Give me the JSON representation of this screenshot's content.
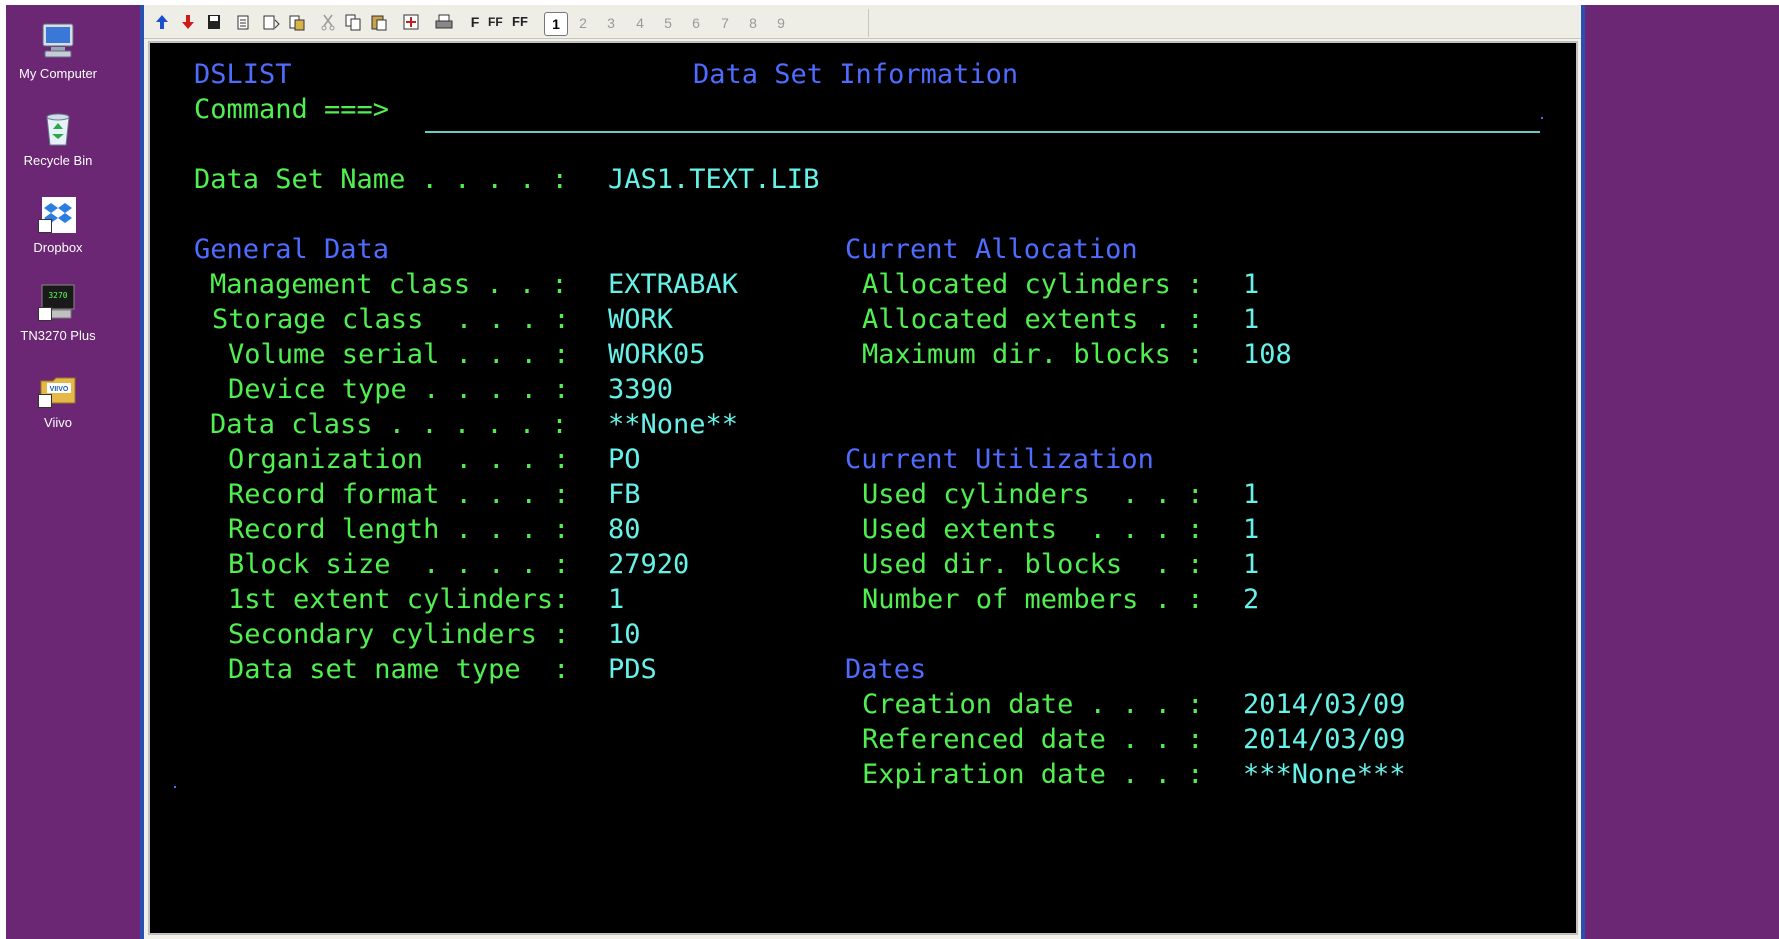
{
  "desktop": {
    "icons": [
      {
        "label": "My Computer"
      },
      {
        "label": "Recycle Bin"
      },
      {
        "label": "Dropbox"
      },
      {
        "label": "TN3270 Plus",
        "badge": "3270"
      },
      {
        "label": "Viivo",
        "badge": "VIIVO"
      }
    ]
  },
  "toolbar": {
    "font_buttons": [
      "F",
      "FF",
      "FF"
    ],
    "pages": [
      "1",
      "2",
      "3",
      "4",
      "5",
      "6",
      "7",
      "8",
      "9"
    ]
  },
  "screen": {
    "panel_id": "DSLIST",
    "title": "Data Set Information",
    "command_label": "Command ===>",
    "command_value": "",
    "dsn_label": "Data Set Name . . . . :",
    "dsn_value": "JAS1.TEXT.LIB",
    "general_title": "General Data",
    "general": [
      {
        "label": "Management class . . :",
        "value": "EXTRABAK"
      },
      {
        "label": "Storage class  . . . :",
        "value": "WORK"
      },
      {
        "label": "Volume serial . . . :",
        "value": "WORK05"
      },
      {
        "label": "Device type . . . . :",
        "value": "3390"
      },
      {
        "label": "Data class . . . . . :",
        "value": "**None**"
      },
      {
        "label": "Organization  . . . :",
        "value": "PO"
      },
      {
        "label": "Record format . . . :",
        "value": "FB"
      },
      {
        "label": "Record length . . . :",
        "value": "80"
      },
      {
        "label": "Block size  . . . . :",
        "value": "27920"
      },
      {
        "label": "1st extent cylinders:",
        "value": "1"
      },
      {
        "label": "Secondary cylinders :",
        "value": "10"
      },
      {
        "label": "Data set name type  :",
        "value": "PDS"
      }
    ],
    "allocation_title": "Current Allocation",
    "allocation": [
      {
        "label": "Allocated cylinders :",
        "value": "1"
      },
      {
        "label": "Allocated extents . :",
        "value": "1"
      },
      {
        "label": "Maximum dir. blocks :",
        "value": "108"
      }
    ],
    "utilization_title": "Current Utilization",
    "utilization": [
      {
        "label": "Used cylinders  . . :",
        "value": "1"
      },
      {
        "label": "Used extents  . . . :",
        "value": "1"
      },
      {
        "label": "Used dir. blocks  . :",
        "value": "1"
      },
      {
        "label": "Number of members . :",
        "value": "2"
      }
    ],
    "dates_title": "Dates",
    "dates": [
      {
        "label": "Creation date . . . :",
        "value": "2014/03/09"
      },
      {
        "label": "Referenced date . . :",
        "value": "2014/03/09"
      },
      {
        "label": "Expiration date . . :",
        "value": "***None***"
      }
    ]
  },
  "colors": {
    "desktop": "#6b2773",
    "terminal_bg": "#000000",
    "field_label": "#50f050",
    "field_value": "#66f2e8",
    "heading": "#4f6cff"
  }
}
